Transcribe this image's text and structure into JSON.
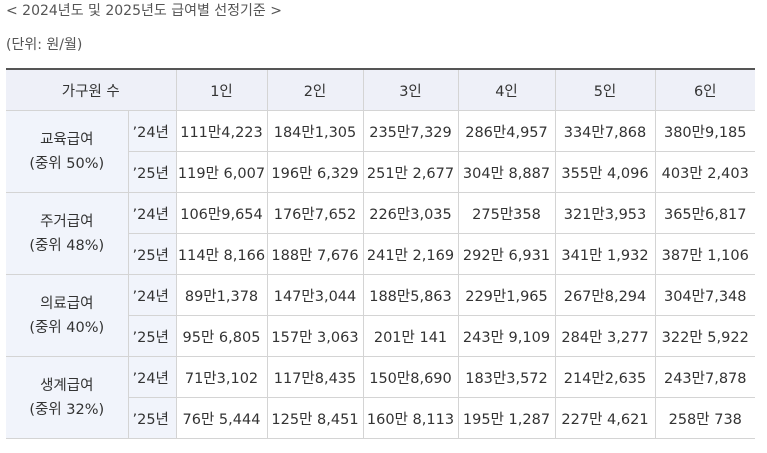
{
  "caption": "< 2024년도 및 2025년도 급여별 선정기준 >",
  "unit": "(단위: 원/월)",
  "table": {
    "header_label": "가구원 수",
    "columns": [
      "1인",
      "2인",
      "3인",
      "4인",
      "5인",
      "6인"
    ],
    "groups": [
      {
        "name": "교육급여",
        "rate": "(중위 50%)",
        "rows": [
          {
            "year": "’24년",
            "values": [
              "111만4,223",
              "184만1,305",
              "235만7,329",
              "286만4,957",
              "334만7,868",
              "380만9,185"
            ]
          },
          {
            "year": "’25년",
            "values": [
              "119만 6,007",
              "196만 6,329",
              "251만 2,677",
              "304만 8,887",
              "355만 4,096",
              "403만 2,403"
            ]
          }
        ]
      },
      {
        "name": "주거급여",
        "rate": "(중위 48%)",
        "rows": [
          {
            "year": "’24년",
            "values": [
              "106만9,654",
              "176만7,652",
              "226만3,035",
              "275만358",
              "321만3,953",
              "365만6,817"
            ]
          },
          {
            "year": "’25년",
            "values": [
              "114만 8,166",
              "188만 7,676",
              "241만 2,169",
              "292만 6,931",
              "341만 1,932",
              "387만 1,106"
            ]
          }
        ]
      },
      {
        "name": "의료급여",
        "rate": "(중위 40%)",
        "rows": [
          {
            "year": "’24년",
            "values": [
              "89만1,378",
              "147만3,044",
              "188만5,863",
              "229만1,965",
              "267만8,294",
              "304만7,348"
            ]
          },
          {
            "year": "’25년",
            "values": [
              "95만 6,805",
              "157만 3,063",
              "201만 141",
              "243만 9,109",
              "284만 3,277",
              "322만 5,922"
            ]
          }
        ]
      },
      {
        "name": "생계급여",
        "rate": "(중위 32%)",
        "rows": [
          {
            "year": "’24년",
            "values": [
              "71만3,102",
              "117만8,435",
              "150만8,690",
              "183만3,572",
              "214만2,635",
              "243만7,878"
            ]
          },
          {
            "year": "’25년",
            "values": [
              "76만 5,444",
              "125만 8,451",
              "160만 8,113",
              "195만 1,287",
              "227만 4,621",
              "258만 738"
            ]
          }
        ]
      }
    ]
  }
}
